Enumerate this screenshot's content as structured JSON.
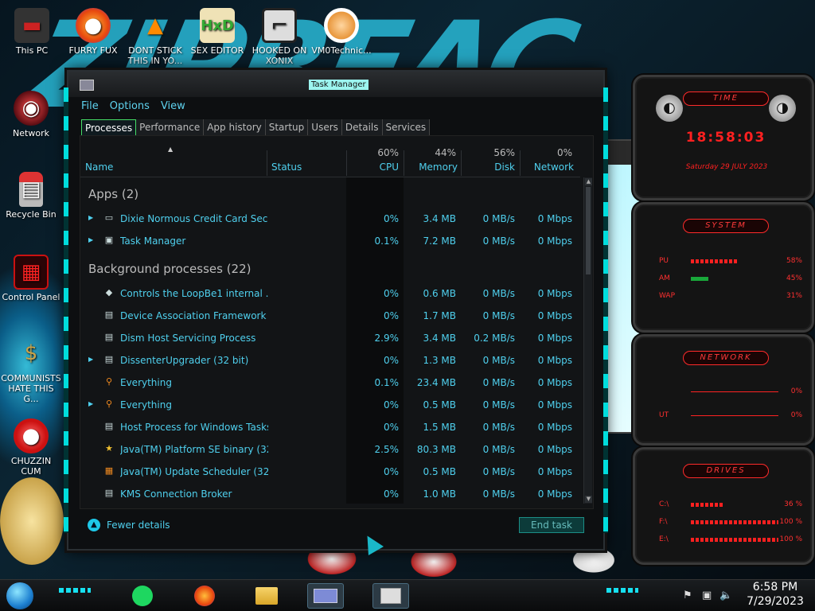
{
  "desktop_icons": [
    {
      "label": "This PC",
      "icon": "pc-icon"
    },
    {
      "label": "FURRY FUX",
      "icon": "firefox-icon"
    },
    {
      "label": "DONT STICK THIS IN YO...",
      "icon": "vlc-icon"
    },
    {
      "label": "SEX EDITOR",
      "icon": "hex-editor-icon"
    },
    {
      "label": "HOOKED ON XONIX",
      "icon": "xonix-icon"
    },
    {
      "label": "VM0Technic...",
      "icon": "technician-icon"
    },
    {
      "label": "Network",
      "icon": "network-icon"
    },
    {
      "label": "Recycle Bin",
      "icon": "recycle-bin-icon"
    },
    {
      "label": "Control Panel",
      "icon": "control-panel-icon"
    },
    {
      "label": "COMMUNISTS HATE THIS G...",
      "icon": "money-bag-icon"
    },
    {
      "label": "CHUZZIN CUM",
      "icon": "chuzzle-icon"
    }
  ],
  "window": {
    "title": "Task Manager",
    "menu": [
      "File",
      "Options",
      "View"
    ],
    "tabs": [
      "Processes",
      "Performance",
      "App history",
      "Startup",
      "Users",
      "Details",
      "Services"
    ],
    "active_tab": "Processes"
  },
  "columns": {
    "name": "Name",
    "status": "Status",
    "cpu": {
      "pct": "60%",
      "label": "CPU"
    },
    "memory": {
      "pct": "44%",
      "label": "Memory"
    },
    "disk": {
      "pct": "56%",
      "label": "Disk"
    },
    "network": {
      "pct": "0%",
      "label": "Network"
    }
  },
  "groups": {
    "apps": "Apps (2)",
    "background": "Background processes (22)"
  },
  "apps": [
    {
      "name": "Dixie Normous Credit Card Secu...",
      "cpu": "0%",
      "memory": "3.4 MB",
      "disk": "0 MB/s",
      "network": "0 Mbps",
      "expandable": true,
      "icon": "card-icon"
    },
    {
      "name": "Task Manager",
      "cpu": "0.1%",
      "memory": "7.2 MB",
      "disk": "0 MB/s",
      "network": "0 Mbps",
      "expandable": true,
      "icon": "task-manager-icon"
    }
  ],
  "background": [
    {
      "name": "Controls the LoopBe1 internal ...",
      "cpu": "0%",
      "memory": "0.6 MB",
      "disk": "0 MB/s",
      "network": "0 Mbps",
      "expandable": false,
      "icon": "loopbe-icon"
    },
    {
      "name": "Device Association Framework ...",
      "cpu": "0%",
      "memory": "1.7 MB",
      "disk": "0 MB/s",
      "network": "0 Mbps",
      "expandable": false,
      "icon": "process-icon"
    },
    {
      "name": "Dism Host Servicing Process",
      "cpu": "2.9%",
      "memory": "3.4 MB",
      "disk": "0.2 MB/s",
      "network": "0 Mbps",
      "expandable": false,
      "icon": "process-icon"
    },
    {
      "name": "DissenterUpgrader (32 bit)",
      "cpu": "0%",
      "memory": "1.3 MB",
      "disk": "0 MB/s",
      "network": "0 Mbps",
      "expandable": true,
      "icon": "process-icon"
    },
    {
      "name": "Everything",
      "cpu": "0.1%",
      "memory": "23.4 MB",
      "disk": "0 MB/s",
      "network": "0 Mbps",
      "expandable": false,
      "icon": "search-icon"
    },
    {
      "name": "Everything",
      "cpu": "0%",
      "memory": "0.5 MB",
      "disk": "0 MB/s",
      "network": "0 Mbps",
      "expandable": true,
      "icon": "search-icon"
    },
    {
      "name": "Host Process for Windows Tasks",
      "cpu": "0%",
      "memory": "1.5 MB",
      "disk": "0 MB/s",
      "network": "0 Mbps",
      "expandable": false,
      "icon": "process-icon"
    },
    {
      "name": "Java(TM) Platform SE binary (32...",
      "cpu": "2.5%",
      "memory": "80.3 MB",
      "disk": "0 MB/s",
      "network": "0 Mbps",
      "expandable": false,
      "icon": "java-icon"
    },
    {
      "name": "Java(TM) Update Scheduler (32 ...",
      "cpu": "0%",
      "memory": "0.5 MB",
      "disk": "0 MB/s",
      "network": "0 Mbps",
      "expandable": false,
      "icon": "java-update-icon"
    },
    {
      "name": "KMS Connection Broker",
      "cpu": "0%",
      "memory": "1.0 MB",
      "disk": "0 MB/s",
      "network": "0 Mbps",
      "expandable": false,
      "icon": "process-icon"
    }
  ],
  "footer": {
    "fewer_details": "Fewer details",
    "end_task": "End task"
  },
  "widgets": {
    "time": {
      "title": "TIME",
      "clock": "18:58:03",
      "date": "Saturday 29 JULY 2023"
    },
    "system": {
      "title": "SYSTEM",
      "rows": [
        {
          "label": "PU",
          "value": "58%",
          "level": 0.58
        },
        {
          "label": "AM",
          "value": "45%",
          "level": 0.45
        },
        {
          "label": "WAP",
          "value": "31%",
          "level": 0.31
        }
      ]
    },
    "network": {
      "title": "NETWORK",
      "rows": [
        {
          "label": "",
          "value": "0%"
        },
        {
          "label": "UT",
          "value": "0%"
        }
      ]
    },
    "drives": {
      "title": "DRIVES",
      "rows": [
        {
          "label": "C:\\",
          "value": "36 %",
          "level": 0.36
        },
        {
          "label": "F:\\",
          "value": "100 %",
          "level": 1.0
        },
        {
          "label": "E:\\",
          "value": "100 %",
          "level": 1.0
        }
      ]
    }
  },
  "taskbar": {
    "buttons": [
      "spotify-icon",
      "firefox-icon",
      "file-explorer-icon",
      "card-app-icon",
      "task-manager-icon"
    ],
    "time": "6:58 PM",
    "date": "7/29/2023"
  },
  "colors": {
    "accent": "#4fd0ee",
    "widget_red": "#ff2020",
    "cyan_frame": "#16e0f0"
  }
}
